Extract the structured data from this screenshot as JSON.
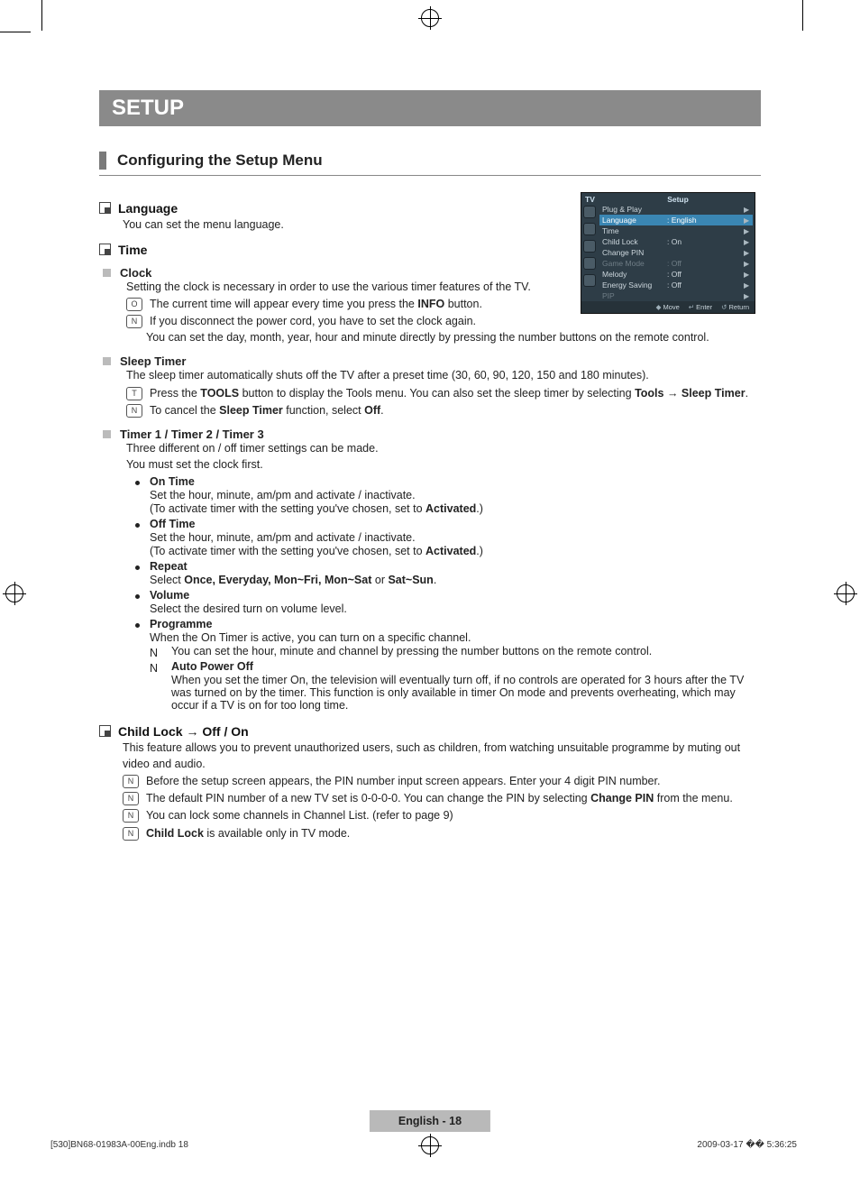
{
  "banner": "SETUP",
  "sectionTitle": "Configuring the Setup Menu",
  "language": {
    "title": "Language",
    "body": "You can set the menu language."
  },
  "time": {
    "title": "Time",
    "clock": {
      "title": "Clock",
      "body": "Setting the clock is necessary in order to use the various timer features of the TV.",
      "note1_pre": "The current time will appear every time you press the ",
      "note1_b": "INFO",
      "note1_post": " button.",
      "note2": "If you disconnect the power cord, you have to set the clock again.",
      "note2b": "You can set the day, month, year, hour and minute directly by pressing the number buttons on the remote control."
    },
    "sleep": {
      "title": "Sleep Timer",
      "body": "The sleep timer automatically shuts off the TV after a preset time (30, 60, 90, 120, 150 and 180 minutes).",
      "n1_pre": "Press the ",
      "n1_b1": "TOOLS",
      "n1_mid": " button to display the Tools menu. You can also set the sleep timer by selecting ",
      "n1_b2": "Tools",
      "n1_arrow": " → ",
      "n1_b3": "Sleep Timer",
      "n1_post": ".",
      "n2_pre": "To cancel the ",
      "n2_b1": "Sleep Timer",
      "n2_mid": " function, select ",
      "n2_b2": "Off",
      "n2_post": "."
    },
    "timers": {
      "title": "Timer 1 / Timer 2 / Timer 3",
      "body1": "Three different on / off timer settings can be made.",
      "body2": "You must set the clock first.",
      "items": {
        "onTime": {
          "h": "On Time",
          "l1": "Set the hour, minute, am/pm and activate / inactivate.",
          "l2_pre": "(To activate timer with the setting you've chosen, set to ",
          "l2_b": "Activated",
          "l2_post": ".)"
        },
        "offTime": {
          "h": "Off Time",
          "l1": "Set the hour, minute, am/pm and activate / inactivate.",
          "l2_pre": "(To activate timer with the setting you've chosen, set to ",
          "l2_b": "Activated",
          "l2_post": ".)"
        },
        "repeat": {
          "h": "Repeat",
          "l1_pre": "Select ",
          "l1_b": "Once, Everyday, Mon~Fri, Mon~Sat",
          "l1_mid": " or ",
          "l1_b2": "Sat~Sun",
          "l1_post": "."
        },
        "volume": {
          "h": "Volume",
          "l1": "Select the desired turn on volume level."
        },
        "programme": {
          "h": "Programme",
          "l1": "When the On Timer is active, you can turn on a specific channel.",
          "n1": "You can set the hour, minute and channel by pressing the number buttons on the remote control.",
          "n2_h": "Auto Power Off",
          "n2_b": "When you set the timer On, the television will eventually turn off, if no controls are operated for 3 hours after the TV was turned on by the timer. This function is only available in timer On mode and prevents overheating, which may occur if a TV is on for too long time."
        }
      }
    }
  },
  "childLock": {
    "title": "Child Lock → Off / On",
    "body": "This feature allows you to prevent unauthorized users, such as children, from watching unsuitable programme by muting out video and audio.",
    "n1": "Before the setup screen appears, the PIN number input screen appears. Enter your 4 digit PIN number.",
    "n2_pre": "The default PIN number of a new TV set is 0-0-0-0. You can change the PIN by selecting ",
    "n2_b": "Change PIN",
    "n2_post": " from the menu.",
    "n3": "You can lock some channels in Channel List. (refer to page 9)",
    "n4_b": "Child Lock",
    "n4_post": " is available only in TV mode."
  },
  "osd": {
    "tv": "TV",
    "caption": "Setup",
    "rows": [
      {
        "k": "Plug & Play",
        "v": "",
        "sel": false,
        "dim": false
      },
      {
        "k": "Language",
        "v": ": English",
        "sel": true,
        "dim": false
      },
      {
        "k": "Time",
        "v": "",
        "sel": false,
        "dim": false
      },
      {
        "k": "Child Lock",
        "v": ": On",
        "sel": false,
        "dim": false
      },
      {
        "k": "Change PIN",
        "v": "",
        "sel": false,
        "dim": false
      },
      {
        "k": "Game Mode",
        "v": ": Off",
        "sel": false,
        "dim": true
      },
      {
        "k": "Melody",
        "v": ": Off",
        "sel": false,
        "dim": false
      },
      {
        "k": "Energy Saving",
        "v": ": Off",
        "sel": false,
        "dim": false
      },
      {
        "k": "PIP",
        "v": "",
        "sel": false,
        "dim": true
      }
    ],
    "foot": {
      "move": "Move",
      "enter": "Enter",
      "ret": "Return"
    }
  },
  "footer": {
    "page": "English - 18",
    "left": "[530]BN68-01983A-00Eng.indb   18",
    "right": "2009-03-17   �� 5:36:25"
  }
}
